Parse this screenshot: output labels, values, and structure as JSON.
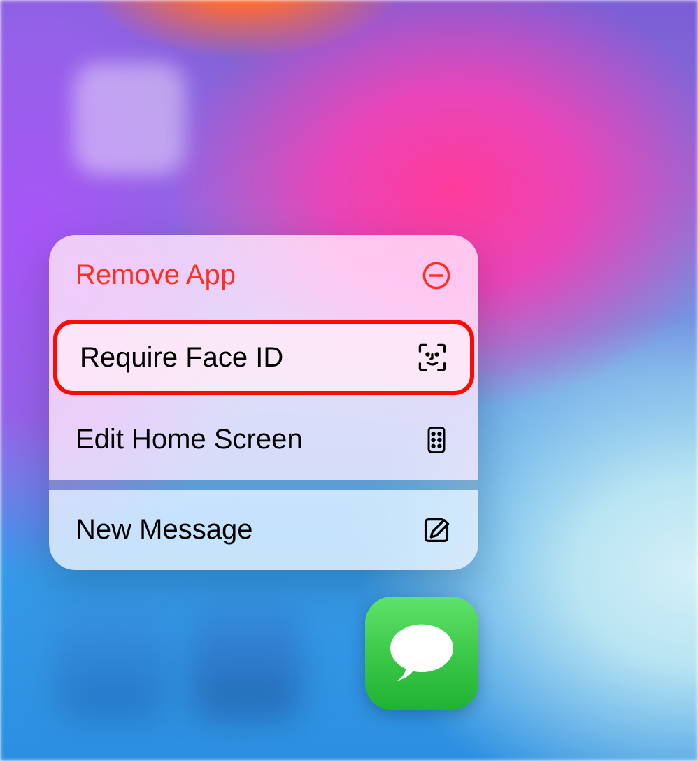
{
  "contextMenu": {
    "items": [
      {
        "label": "Remove App",
        "icon": "remove-circle-icon",
        "destructive": true
      },
      {
        "label": "Require Face ID",
        "icon": "face-id-icon",
        "highlighted": true
      },
      {
        "label": "Edit Home Screen",
        "icon": "apps-grid-icon"
      },
      {
        "label": "New Message",
        "icon": "compose-icon"
      }
    ]
  },
  "app": {
    "name": "Messages"
  }
}
